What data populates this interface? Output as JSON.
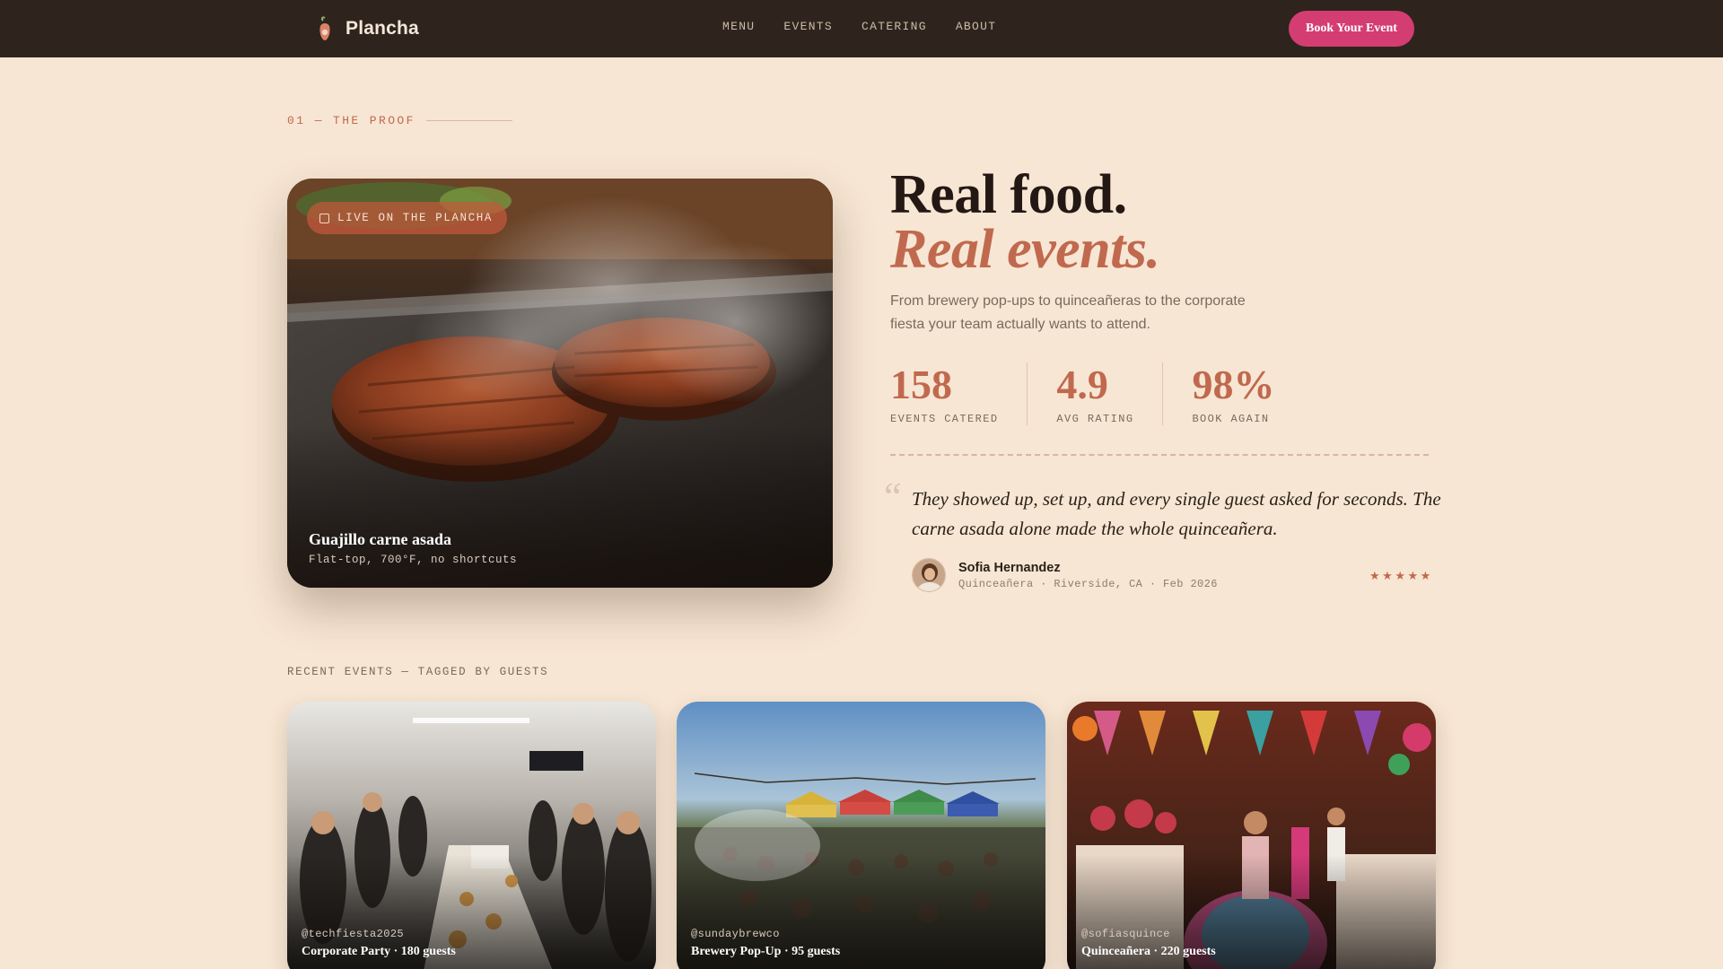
{
  "nav": {
    "brand": "Plancha",
    "links": [
      "MENU",
      "EVENTS",
      "CATERING",
      "ABOUT"
    ],
    "cta": "Book Your Event"
  },
  "section": {
    "eyebrow": "01 — THE PROOF"
  },
  "hero_card": {
    "badge": "LIVE ON THE PLANCHA",
    "title": "Guajillo carne asada",
    "subtitle": "Flat-top, 700°F, no shortcuts"
  },
  "headline": {
    "line1": "Real food.",
    "line2": "Real events."
  },
  "subcopy": "From brewery pop-ups to quinceañeras to the corporate fiesta your team actually wants to attend.",
  "stats": [
    {
      "value": "158",
      "label": "EVENTS CATERED"
    },
    {
      "value": "4.9",
      "label": "AVG RATING"
    },
    {
      "value": "98%",
      "label": "BOOK AGAIN"
    }
  ],
  "testimonial": {
    "quote": "They showed up, set up, and every single guest asked for seconds. The carne asada alone made the whole quinceañera.",
    "author": "Sofia Hernandez",
    "meta": "Quinceañera · Riverside, CA · Feb 2026",
    "rating": 5
  },
  "recent": {
    "label": "RECENT EVENTS — TAGGED BY GUESTS",
    "events": [
      {
        "handle": "@techfiesta2025",
        "title": "Corporate Party · 180 guests"
      },
      {
        "handle": "@sundaybrewco",
        "title": "Brewery Pop-Up · 95 guests"
      },
      {
        "handle": "@sofiasquince",
        "title": "Quinceañera · 220 guests"
      }
    ]
  },
  "colors": {
    "nav_bg": "#2f241d",
    "page_bg": "#f7e6d3",
    "accent": "#c0694e",
    "cta": "#d33d72"
  }
}
